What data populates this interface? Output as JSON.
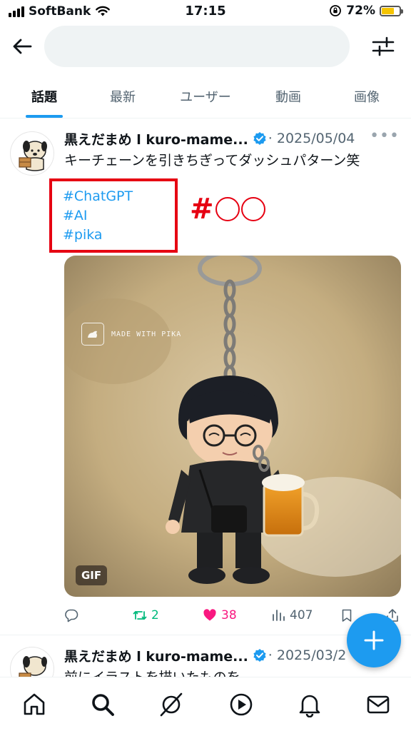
{
  "status_bar": {
    "carrier": "SoftBank",
    "time": "17:15",
    "battery": "72%",
    "battery_level": 0.72,
    "icons": [
      "signal-icon",
      "wifi-icon",
      "orientation-lock-icon",
      "battery-icon"
    ]
  },
  "search": {
    "value": "",
    "placeholder": ""
  },
  "tabs": [
    {
      "label": "話題",
      "active": true
    },
    {
      "label": "最新",
      "active": false
    },
    {
      "label": "ユーザー",
      "active": false
    },
    {
      "label": "動画",
      "active": false
    },
    {
      "label": "画像",
      "active": false
    }
  ],
  "posts": [
    {
      "author": "黒えだまめ l kuro-mame...",
      "verified": true,
      "date": "· 2025/05/04",
      "text": "キーチェーンを引きちぎってダッシュパターン笑",
      "hashtags": [
        "#ChatGPT",
        "#AI",
        "#pika"
      ],
      "media": {
        "badge": "GIF",
        "watermark": "MADE WITH PIKA"
      },
      "actions": {
        "reply": "",
        "retweets": "2",
        "likes": "38",
        "views": "407"
      }
    },
    {
      "author": "黒えだまめ l kuro-mame...",
      "verified": true,
      "date": "· 2025/03/2",
      "text": "前にイラストを描いたものを"
    }
  ],
  "annotation": {
    "text": "#",
    "color": "#e60012"
  },
  "colors": {
    "accent": "#1d9bf0",
    "retweet": "#00ba7c",
    "like": "#f91880",
    "annotation_red": "#e60012"
  },
  "bottom_nav": [
    "home-icon",
    "search-icon",
    "grok-icon",
    "video-icon",
    "notifications-icon",
    "messages-icon"
  ]
}
